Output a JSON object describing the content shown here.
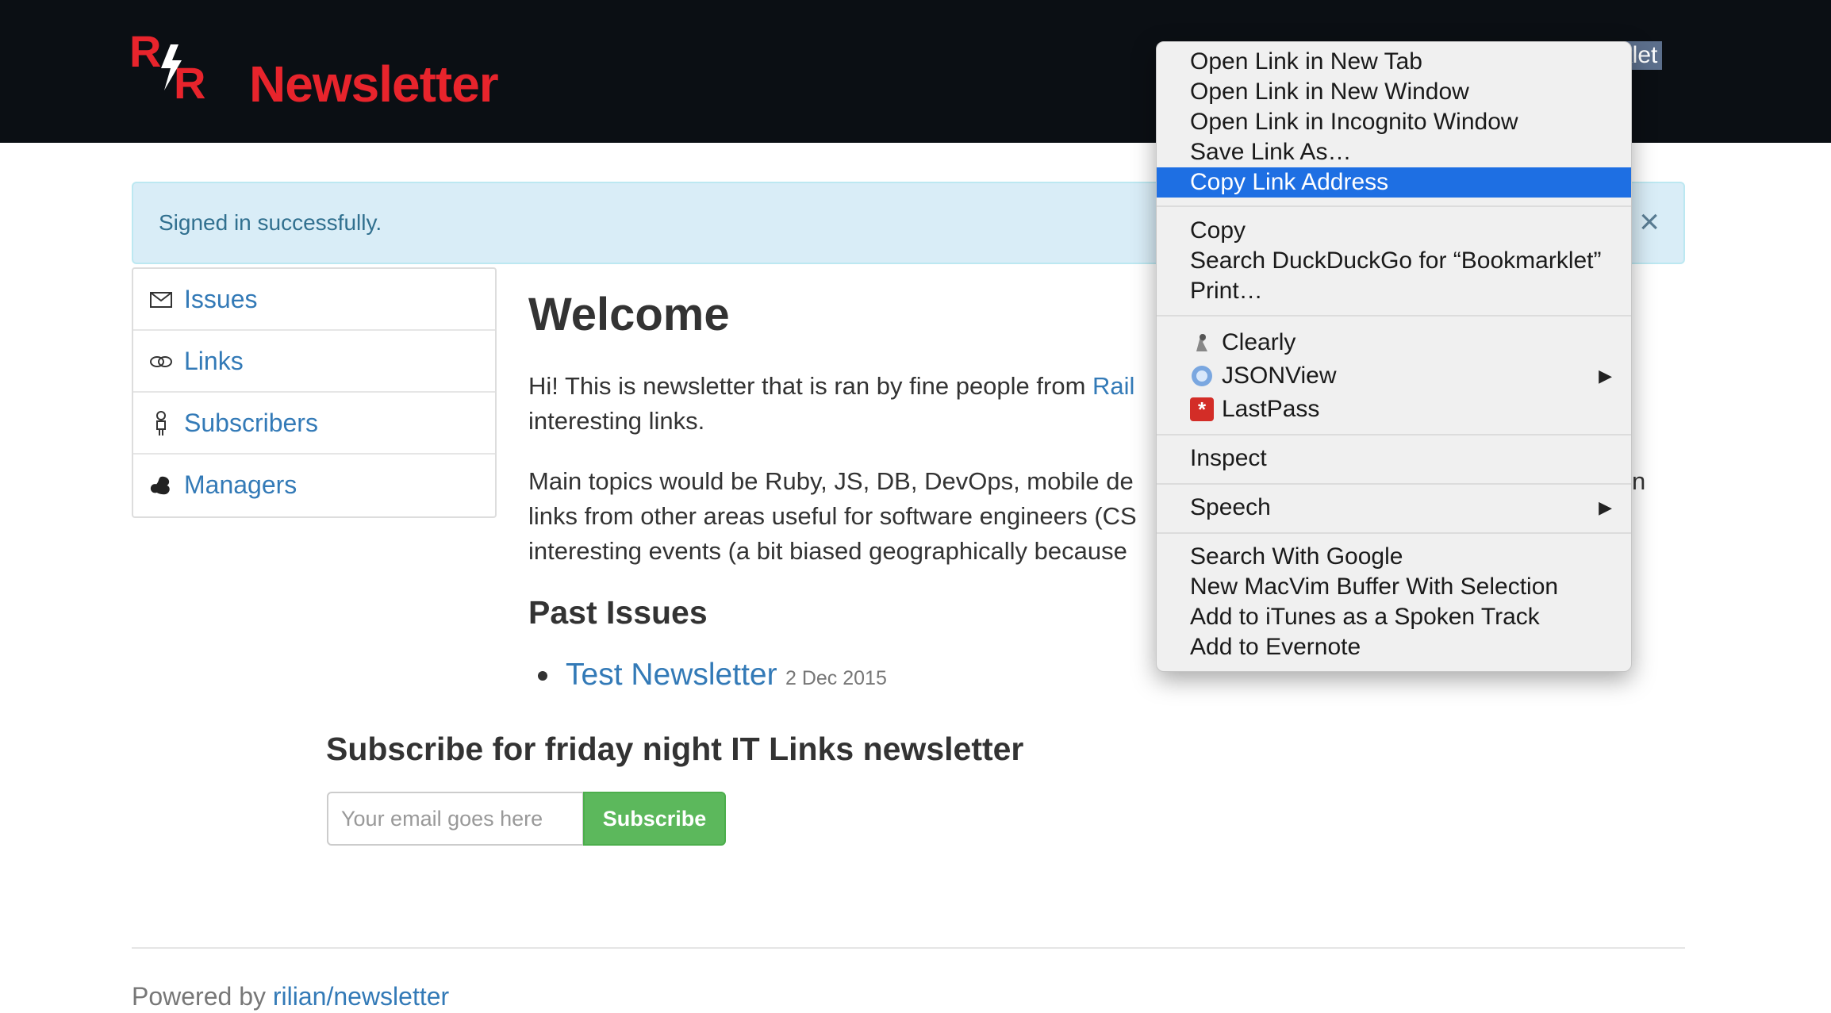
{
  "header": {
    "logo_text": "R R",
    "brand": "Newsletter",
    "bookmarklet_link": "arklet"
  },
  "alert": {
    "message": "Signed in successfully.",
    "close": "×"
  },
  "sidebar": {
    "items": [
      {
        "label": "Issues",
        "icon": "envelope-icon"
      },
      {
        "label": "Links",
        "icon": "link-icon"
      },
      {
        "label": "Subscribers",
        "icon": "person-icon"
      },
      {
        "label": "Managers",
        "icon": "squirrel-icon"
      }
    ]
  },
  "main": {
    "title": "Welcome",
    "intro_prefix": "Hi! This is newsletter that is ran by fine people from ",
    "intro_link": "Rail",
    "intro_line2": "interesting links.",
    "topics_line1": "Main topics would be Ruby, JS, DB, DevOps, mobile de",
    "topics_tail": "n",
    "topics_line2": "links from other areas useful for software engineers (CS",
    "topics_line3": "interesting events (a bit biased geographically because",
    "past_issues_heading": "Past Issues",
    "issues": [
      {
        "title": "Test Newsletter",
        "date": "2 Dec 2015"
      }
    ]
  },
  "subscribe": {
    "heading": "Subscribe for friday night IT Links newsletter",
    "placeholder": "Your email goes here",
    "button": "Subscribe"
  },
  "footer": {
    "prefix": "Powered by ",
    "link": "rilian/newsletter"
  },
  "context_menu": {
    "group1": [
      "Open Link in New Tab",
      "Open Link in New Window",
      "Open Link in Incognito Window",
      "Save Link As…",
      "Copy Link Address"
    ],
    "highlighted": "Copy Link Address",
    "group2": [
      "Copy",
      "Search DuckDuckGo for “Bookmarklet”",
      "Print…"
    ],
    "extensions": [
      {
        "label": "Clearly",
        "icon": "clearly-icon"
      },
      {
        "label": "JSONView",
        "icon": "jsonview-icon",
        "submenu": true
      },
      {
        "label": "LastPass",
        "icon": "lastpass-icon"
      }
    ],
    "inspect": "Inspect",
    "speech": "Speech",
    "services": [
      "Search With Google",
      "New MacVim Buffer With Selection",
      "Add to iTunes as a Spoken Track",
      "Add to Evernote"
    ]
  },
  "colors": {
    "topbar": "#0b0f14",
    "brand_red": "#e8242c",
    "link_blue": "#337ab7",
    "alert_bg": "#d9edf7",
    "subscribe_green": "#5cb85c",
    "menu_highlight": "#1e6fe3"
  }
}
